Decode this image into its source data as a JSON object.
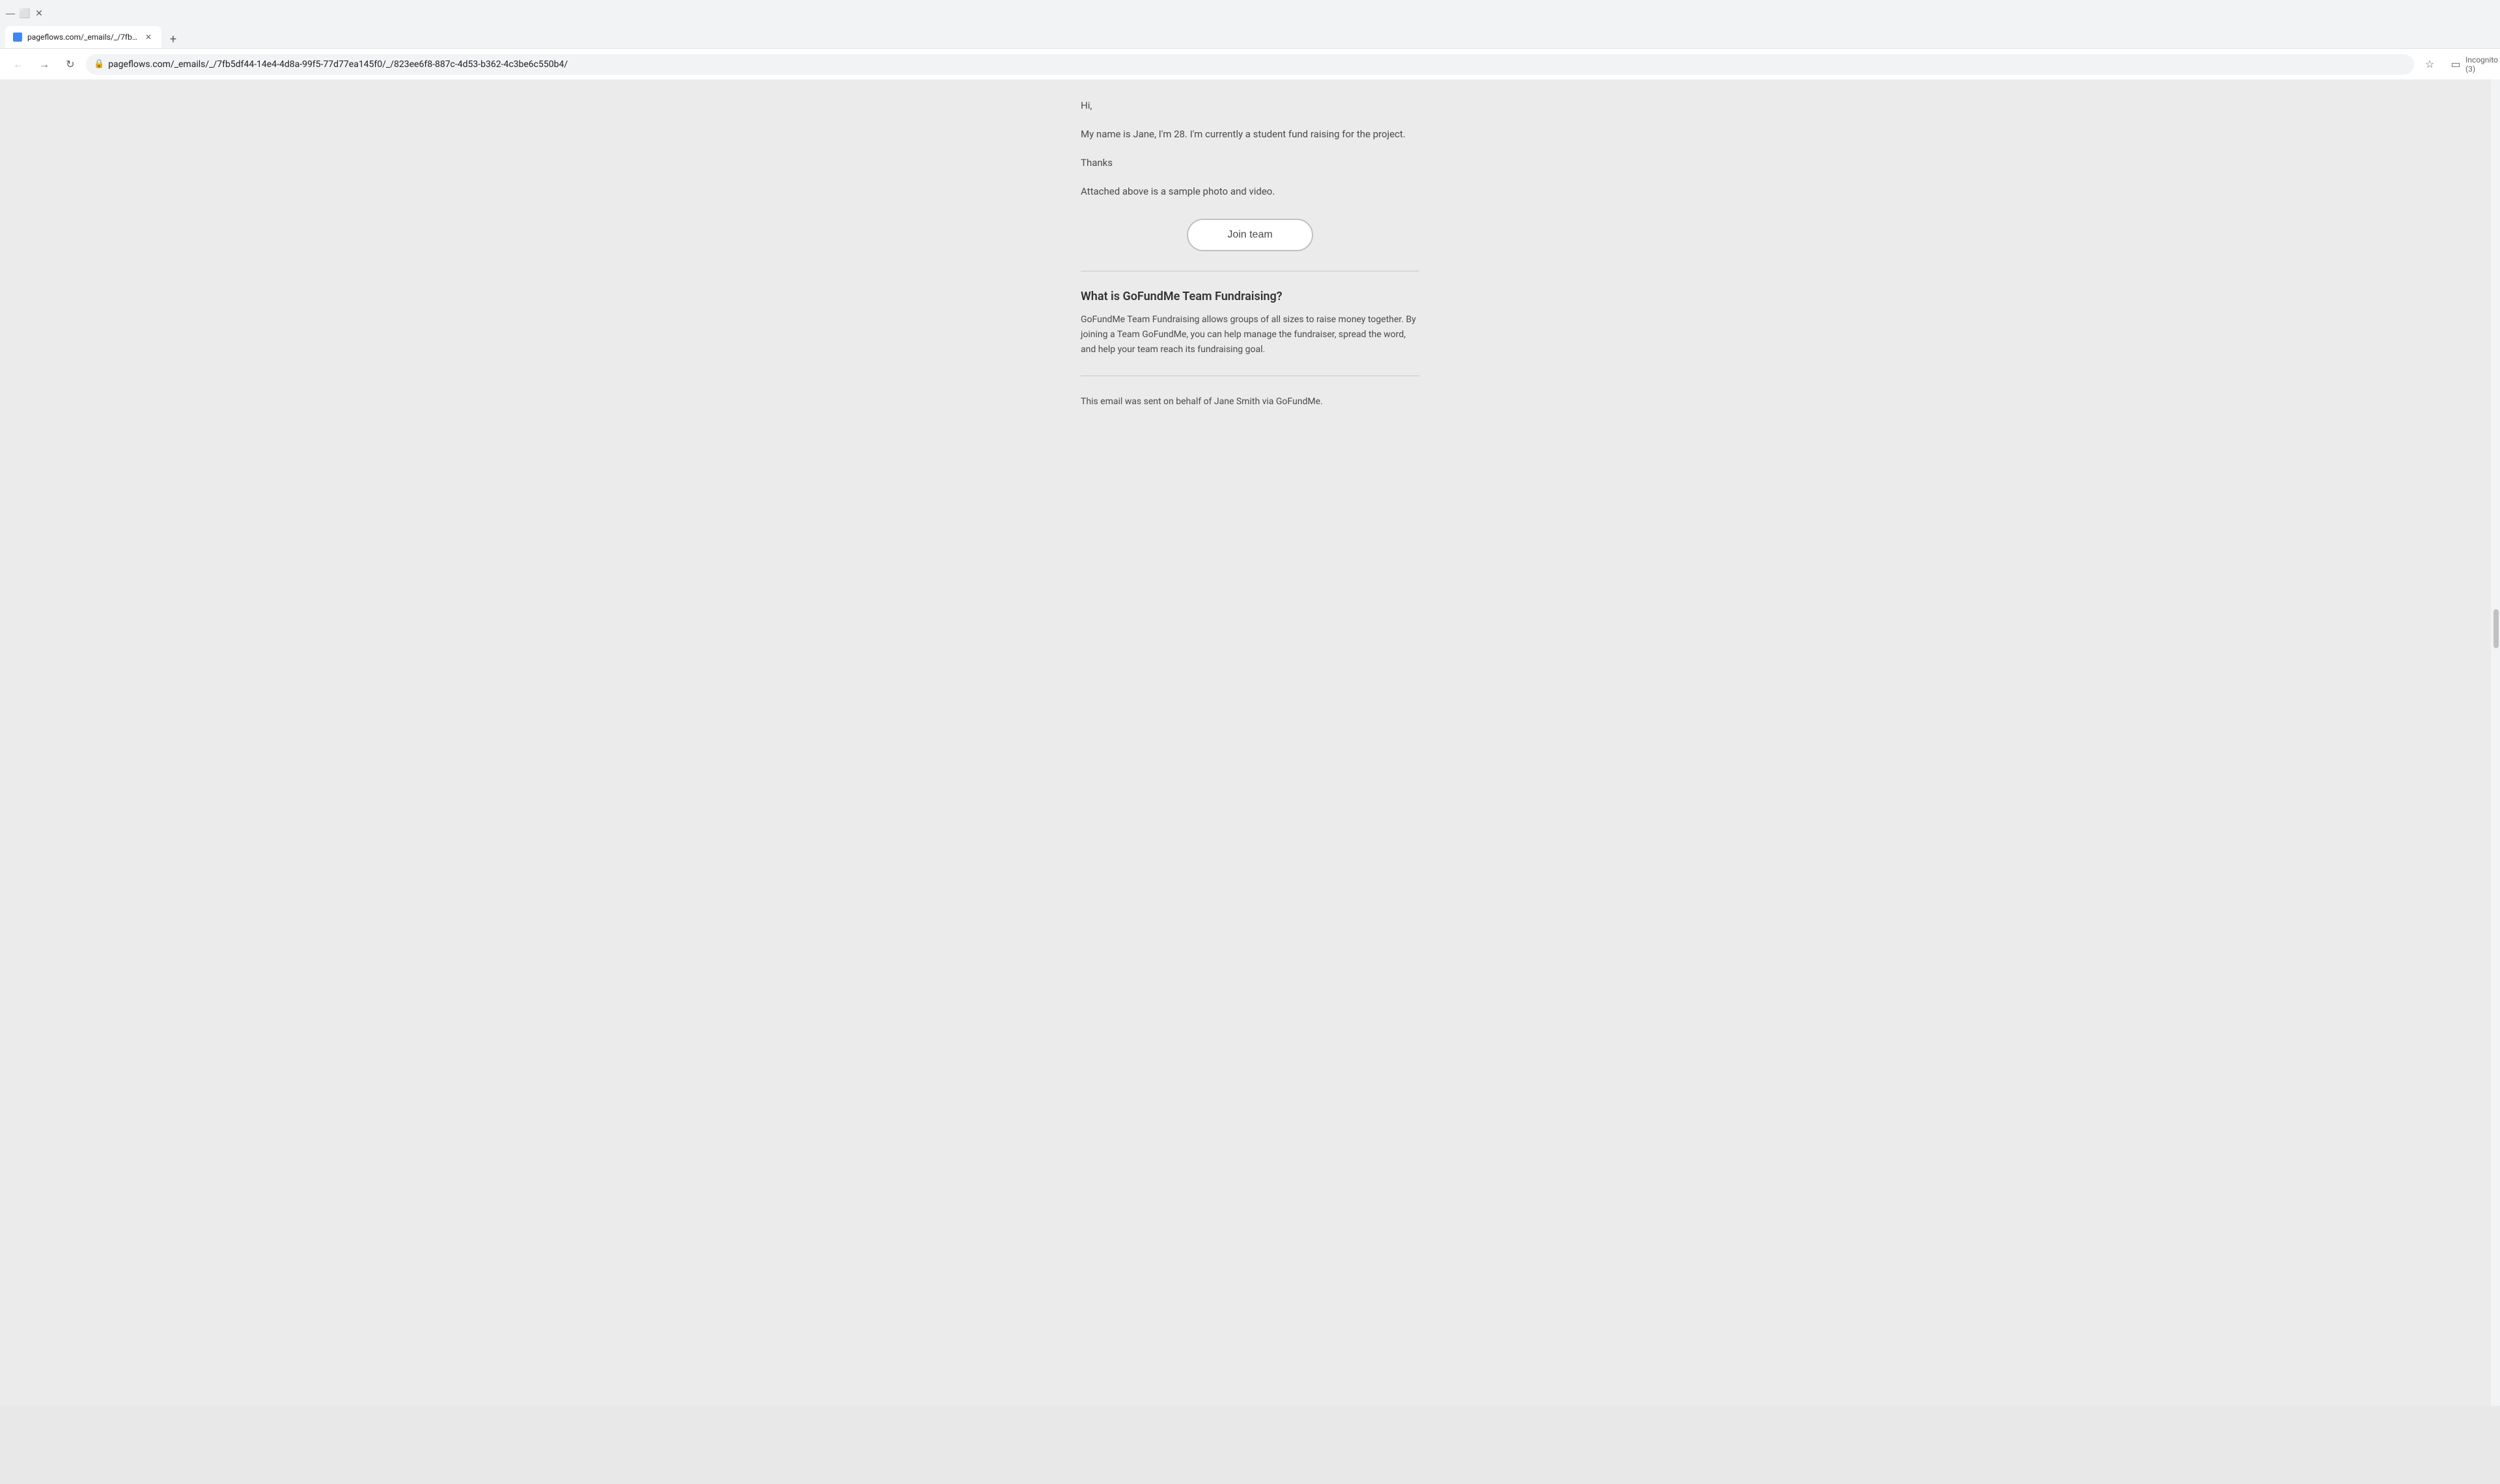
{
  "browser": {
    "tab": {
      "title": "pageflows.com/_emails/_/7fb5...",
      "favicon": "📄"
    },
    "address": "pageflows.com/_emails/_/7fb5df44-14e4-4d8a-99f5-77d77ea145f0/_/823ee6f8-887c-4d53-b362-4c3be6c550b4/",
    "profile": "Incognito (3)"
  },
  "email": {
    "greeting": "Hi,",
    "intro": "My name is Jane, I'm 28. I'm currently a student fund raising for the project.",
    "thanks": "Thanks",
    "attachment_note": "Attached above is a sample photo and video.",
    "join_button_label": "Join team",
    "section_title": "What is GoFundMe Team Fundraising?",
    "section_body": "GoFundMe Team Fundraising allows groups of all sizes to raise money together. By joining a Team GoFundMe, you can help manage the fundraiser, spread the word, and help your team reach its fundraising goal.",
    "footer_text": "This email was sent on behalf of Jane Smith via GoFundMe."
  }
}
